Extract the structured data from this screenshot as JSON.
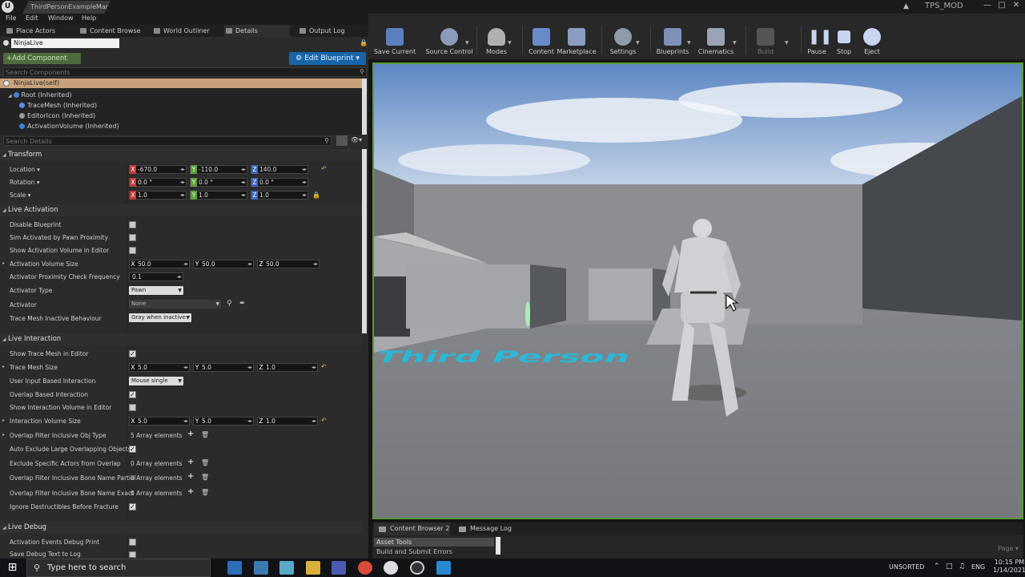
{
  "titlebar": {
    "map_tab": "ThirdPersonExampleMap*",
    "project": "TPS_MOD",
    "logo": "U"
  },
  "menu": [
    "File",
    "Edit",
    "Window",
    "Help"
  ],
  "panel_tabs": [
    "Place Actors",
    "Content Browse",
    "World Outliner",
    "Details",
    "Output Log"
  ],
  "details": {
    "actor_name": "NinjaLive",
    "add_component": "+Add Component",
    "edit_blueprint": "Edit Blueprint",
    "search_components_placeholder": "Search Components",
    "components": {
      "self": "NinjaLive(self)",
      "root": "Root (Inherited)",
      "children": [
        "TraceMesh (Inherited)",
        "EditorIcon (Inherited)",
        "ActivationVolume (Inherited)"
      ]
    },
    "search_details_placeholder": "Search Details"
  },
  "transform": {
    "title": "Transform",
    "location_label": "Location",
    "rotation_label": "Rotation",
    "scale_label": "Scale",
    "location": {
      "x": "-670.0",
      "y": "-110.0",
      "z": "140.0"
    },
    "rotation": {
      "x": "0.0 °",
      "y": "0.0 °",
      "z": "0.0 °"
    },
    "scale": {
      "x": "1.0",
      "y": "1.0",
      "z": "1.0"
    }
  },
  "live_activation": {
    "title": "Live Activation",
    "disable_blueprint": "Disable Blueprint",
    "sim_activated": "Sim Activated by Pawn Proximity",
    "show_activation_volume": "Show Activation Volume in Editor",
    "activation_volume_size": "Activation Volume Size",
    "avs": {
      "x": "50.0",
      "y": "50.0",
      "z": "50.0"
    },
    "proximity_check": "Activator Proximity Check Frequency",
    "proximity_value": "0.1",
    "activator_type": "Activator Type",
    "activator_type_value": "Pawn",
    "activator": "Activator",
    "activator_value": "None",
    "trace_mesh_inactive": "Trace Mesh Inactive Behaviour",
    "trace_mesh_inactive_value": "Gray when inactive"
  },
  "live_interaction": {
    "title": "Live Interaction",
    "show_trace_mesh": "Show Trace Mesh in Editor",
    "trace_mesh_size": "Trace Mesh Size",
    "tms": {
      "x": "5.0",
      "y": "5.0",
      "z": "1.0"
    },
    "user_input": "User Input Based Interaction",
    "user_input_value": "Mouse single",
    "overlap_based": "Overlap Based Interaction",
    "show_interaction_volume": "Show Interaction Volume in Editor",
    "interaction_volume_size": "Interaction Volume Size",
    "ivs": {
      "x": "5.0",
      "y": "5.0",
      "z": "1.0"
    },
    "overlap_filter_obj": "Overlap Filter Inclusive Obj Type",
    "overlap_filter_obj_value": "5 Array elements",
    "auto_exclude": "Auto Exclude Large Overlapping Objects",
    "exclude_actors": "Exclude Specific Actors from Overlap",
    "exclude_actors_value": "0 Array elements",
    "bone_partial": "Overlap Filter Inclusive Bone Name Partial",
    "bone_partial_value": "0 Array elements",
    "bone_exact": "Overlap Filter Inclusive Bone Name Exact",
    "bone_exact_value": "0 Array elements",
    "ignore_destructibles": "Ignore Destructibles Before Fracture"
  },
  "live_debug": {
    "title": "Live Debug",
    "activation_events": "Activation Events Debug Print",
    "save_debug": "Save Debug Text to Log"
  },
  "toolbar": [
    {
      "label": "Save Current",
      "icon": "save-icon",
      "color": "#5b7fbf"
    },
    {
      "label": "Source Control",
      "icon": "source-control-icon",
      "color": "#8a9ab8"
    },
    {
      "label": "Modes",
      "icon": "modes-icon",
      "color": "#b0b0b0"
    },
    {
      "label": "Content",
      "icon": "content-icon",
      "color": "#6a8ac8"
    },
    {
      "label": "Marketplace",
      "icon": "marketplace-icon",
      "color": "#8a9cc0"
    },
    {
      "label": "Settings",
      "icon": "settings-icon",
      "color": "#909aa8"
    },
    {
      "label": "Blueprints",
      "icon": "blueprints-icon",
      "color": "#7e8fb8"
    },
    {
      "label": "Cinematics",
      "icon": "cinematics-icon",
      "color": "#9aa4b4"
    },
    {
      "label": "Build",
      "icon": "build-icon",
      "color": "#555555"
    },
    {
      "label": "Pause",
      "icon": "pause-icon",
      "color": "#c8d4f0"
    },
    {
      "label": "Stop",
      "icon": "stop-icon",
      "color": "#c8d4f0"
    },
    {
      "label": "Eject",
      "icon": "eject-icon",
      "color": "#c8d4f0"
    }
  ],
  "viewport": {
    "floor_text": "Third Person"
  },
  "bottom": {
    "tabs": [
      "Content Browser 2",
      "Message Log"
    ],
    "asset_tools": "Asset Tools",
    "build_submit": "Build and Submit Errors",
    "page": "Page"
  },
  "taskbar": {
    "search_placeholder": "Type here to search",
    "unsorted": "UNSORTED",
    "lang": "ENG",
    "time": "10:15 PM",
    "date": "1/14/2021"
  }
}
